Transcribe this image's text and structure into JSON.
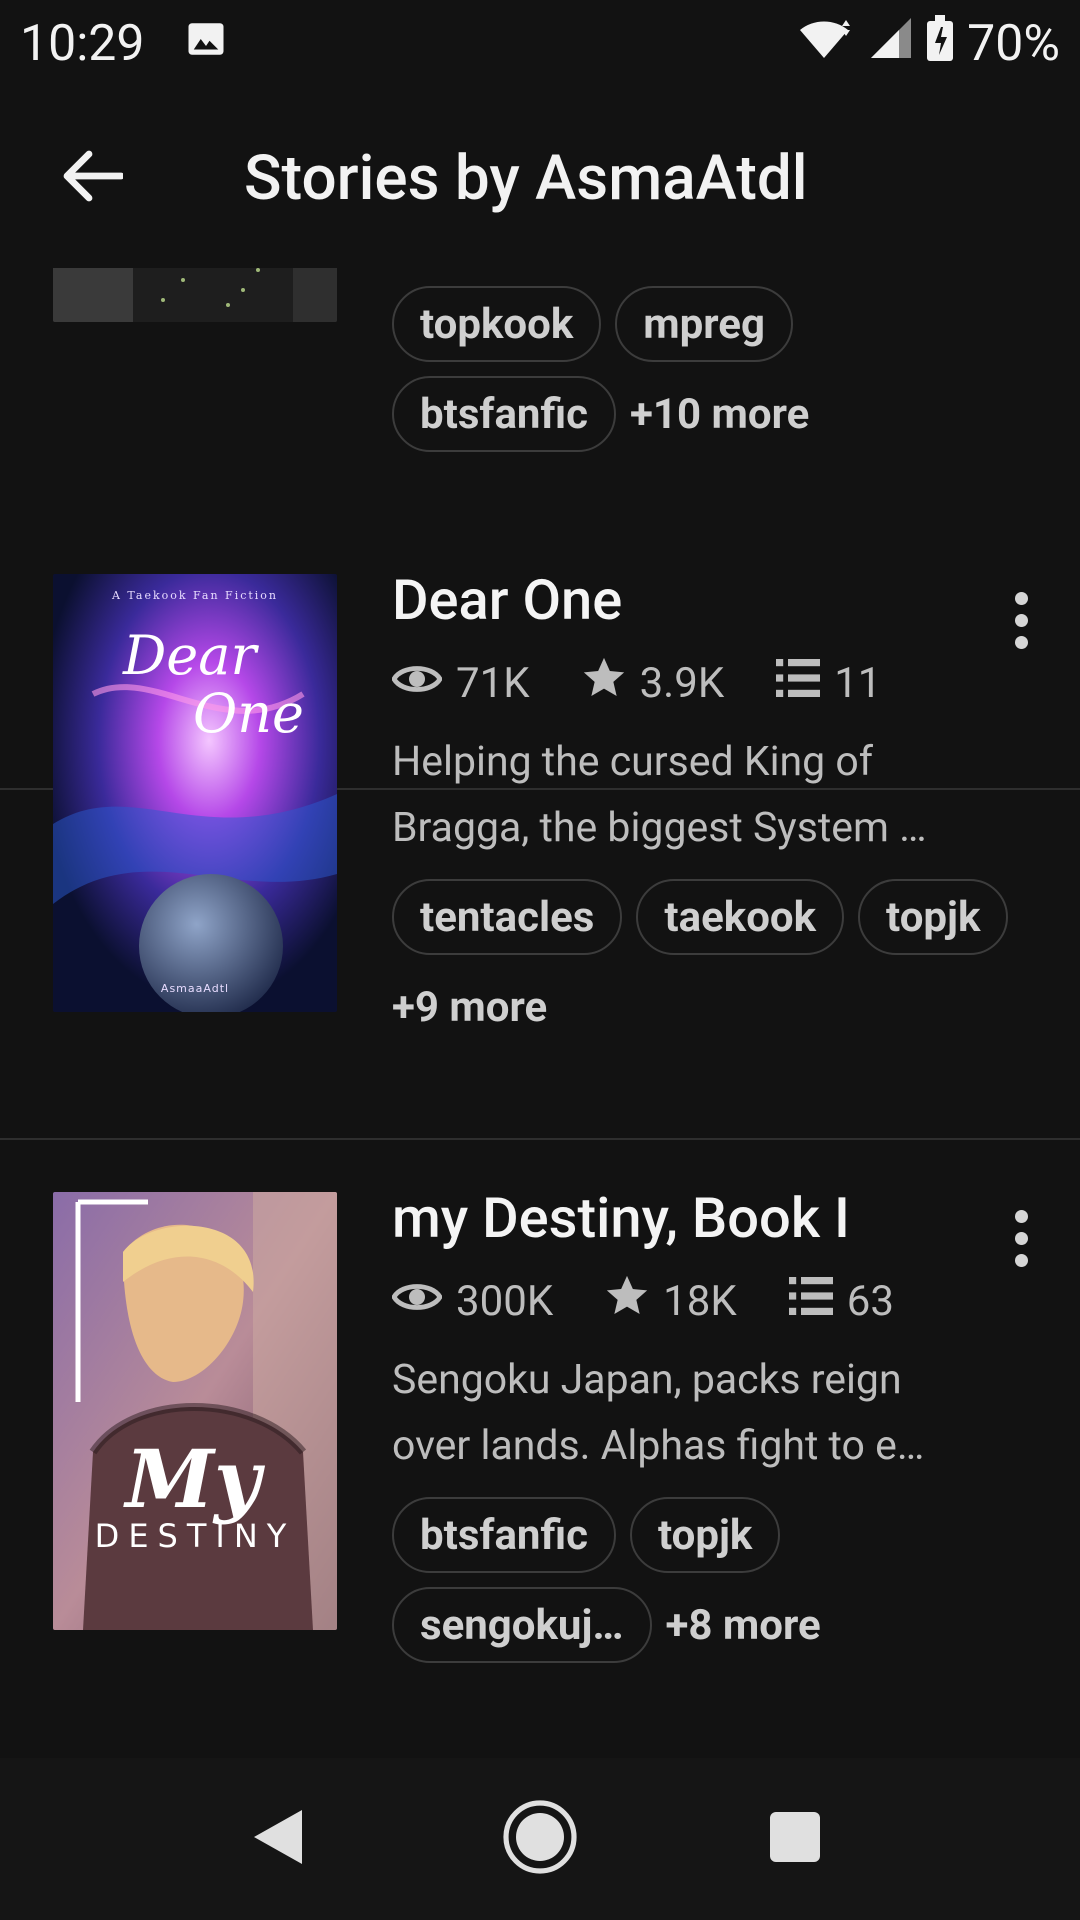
{
  "status": {
    "time": "10:29",
    "battery": "70%"
  },
  "header": {
    "title": "Stories by AsmaAtdl"
  },
  "stories": [
    {
      "tags": [
        "topkook",
        "mpreg",
        "btsfanfic"
      ],
      "more": "+10 more"
    },
    {
      "title": "Dear One",
      "reads": "71K",
      "votes": "3.9K",
      "parts": "11",
      "desc_line1": "Helping the cursed King of",
      "desc_line2": "Bragga, the biggest System …",
      "tags": [
        "tentacles",
        "taekook",
        "topjk"
      ],
      "more": "+9 more",
      "cover_top": "A Taekook Fan Fiction",
      "cover_title1": "Dear",
      "cover_title2": "One",
      "cover_author": "AsmaaAdtl"
    },
    {
      "title": "my Destiny, Book I",
      "reads": "300K",
      "votes": "18K",
      "parts": "63",
      "desc_line1": "Sengoku Japan, packs reign",
      "desc_line2": "over lands. Alphas fight to e…",
      "tags": [
        "btsfanfic",
        "topjk",
        "sengokuj…"
      ],
      "more": "+8 more",
      "cover_title1": "My",
      "cover_title2": "DESTINY"
    }
  ],
  "colors": {
    "background": "#121212",
    "text": "#e8e8e8",
    "muted": "#bdbdbd",
    "divider": "#2e2e2e"
  },
  "icons": [
    "image-icon",
    "wifi-icon",
    "signal-icon",
    "battery-icon",
    "back-arrow-icon",
    "eye-icon",
    "star-icon",
    "list-icon",
    "more-vert-icon",
    "nav-back-icon",
    "nav-home-icon",
    "nav-recents-icon"
  ]
}
